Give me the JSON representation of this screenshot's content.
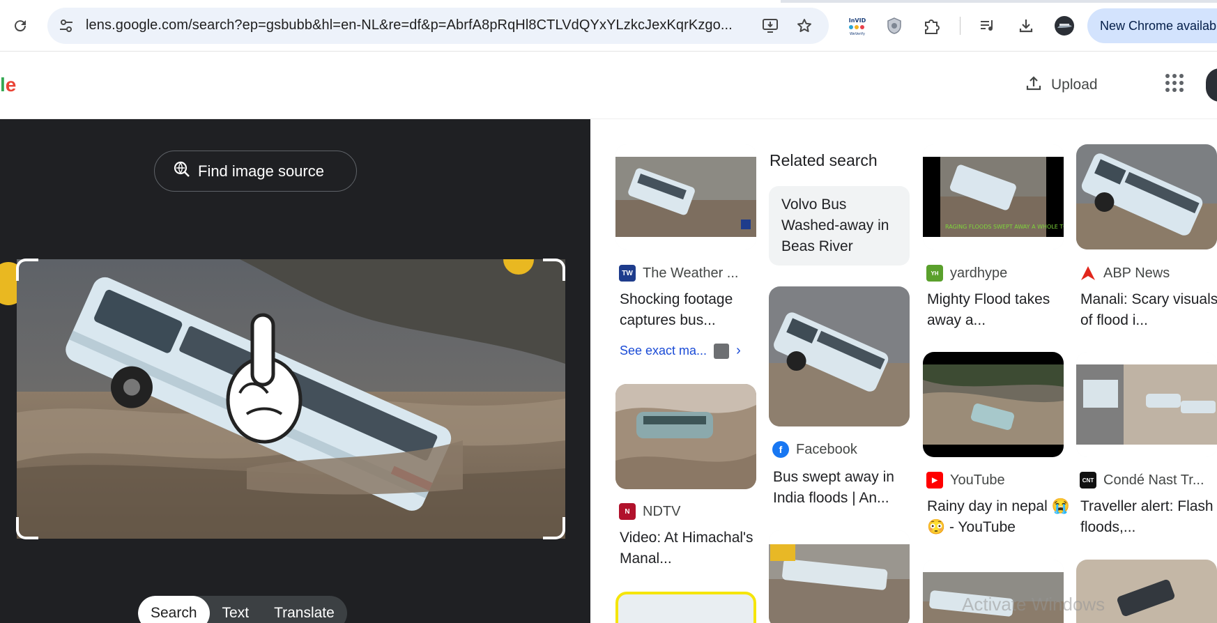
{
  "browser": {
    "url": "lens.google.com/search?ep=gsbubb&hl=en-NL&re=df&p=AbrfA8pRqHl8CTLVdQYxYLzkcJexKqrKzgo...",
    "update_label": "New Chrome available",
    "extension_label": "InVID WeVerify"
  },
  "lens": {
    "logo_fragment": "le",
    "upload_label": "Upload",
    "find_source_label": "Find image source",
    "tabs": [
      "Search",
      "Text",
      "Translate"
    ],
    "active_tab": "Search"
  },
  "results": {
    "related_title": "Related search",
    "related_query": "Volvo Bus Washed-away in Beas River",
    "exact_match_label": "See exact ma...",
    "cards": [
      {
        "source": "The Weather ...",
        "title": "Shocking footage captures bus..."
      },
      {
        "source": "yardhype",
        "title": "Mighty Flood takes away a..."
      },
      {
        "source": "ABP News",
        "title": "Manali: Scary visuals of flood i..."
      },
      {
        "source": "NDTV",
        "title": "Video: At Himachal's Manal..."
      },
      {
        "source": "Facebook",
        "title": "Bus swept away in India floods | An..."
      },
      {
        "source": "YouTube",
        "title": "Rainy day in nepal 😭😳 - YouTube"
      },
      {
        "source": "Condé Nast Tr...",
        "title": "Traveller alert: Flash floods,..."
      }
    ],
    "thumb_caption": "RAGING FLOODS SWEPT AWAY A WHOLE TOURIST BUS AS",
    "watermark": "Activate Windows"
  },
  "colors": {
    "dark_pane": "#1f2023",
    "accent_blue": "#1a4bd6",
    "update_pill": "#d3e3fd"
  },
  "icons": [
    "reload-icon",
    "site-settings-icon",
    "install-icon",
    "star-icon",
    "extension-icon",
    "shield-icon",
    "puzzle-icon",
    "media-icon",
    "download-icon",
    "profile-avatar",
    "upload-icon",
    "apps-grid-icon",
    "lens-search-icon",
    "chevron-right-icon"
  ]
}
